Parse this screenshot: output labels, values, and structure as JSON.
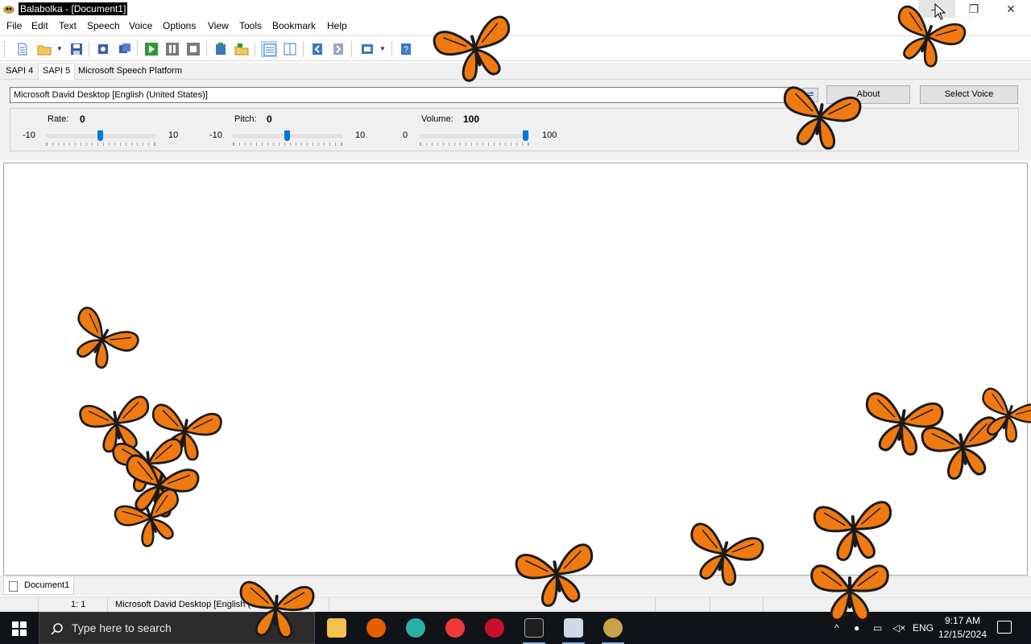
{
  "window": {
    "title": "Balabolka - [Document1]",
    "controls": {
      "minimize": "—",
      "maximize": "❐",
      "close": "✕"
    }
  },
  "menu": [
    "File",
    "Edit",
    "Text",
    "Speech",
    "Voice",
    "Options",
    "View",
    "Tools",
    "Bookmark",
    "Help"
  ],
  "toolbar": {
    "buttons": [
      "new-document-icon",
      "open-file-icon",
      "save-icon",
      "save-audio-icon",
      "batch-convert-icon",
      "play-icon",
      "pause-icon",
      "stop-icon",
      "read-clipboard-icon",
      "open-folder-icon",
      "view-icon",
      "split-icon",
      "prev-icon",
      "next-icon",
      "audio-file-icon",
      "help-icon"
    ]
  },
  "tabs": [
    "SAPI 4",
    "SAPI 5",
    "Microsoft Speech Platform"
  ],
  "selected_tab": "SAPI 5",
  "voice": {
    "selected": "Microsoft David Desktop [English (United States)]",
    "about_label": "About",
    "select_voice_label": "Select Voice"
  },
  "sliders": {
    "rate": {
      "label": "Rate:",
      "value": "0",
      "min": "-10",
      "max": "10",
      "level": 0.5
    },
    "pitch": {
      "label": "Pitch:",
      "value": "0",
      "min": "-10",
      "max": "10",
      "level": 0.5
    },
    "volume": {
      "label": "Volume:",
      "value": "100",
      "min": "0",
      "max": "100",
      "level": 1.0
    }
  },
  "document_tab": "Document1",
  "status": {
    "position": "1:   1",
    "voice": "Microsoft David Desktop [English (United States)]"
  },
  "taskbar": {
    "search_placeholder": "Type here to search",
    "language": "ENG",
    "time": "9:17 AM",
    "date": "12/15/2024"
  },
  "colors": {
    "accent": "#0078d7",
    "taskbar": "#101317",
    "butterfly": "#f07a10"
  }
}
